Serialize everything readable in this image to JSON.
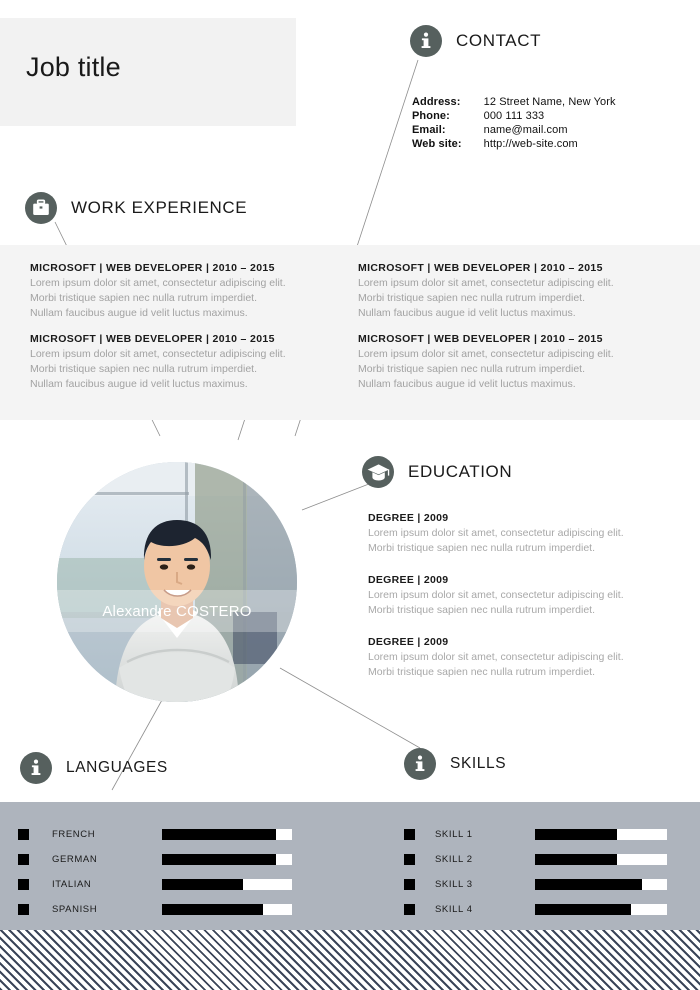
{
  "header": {
    "job_title": "Job title"
  },
  "colors": {
    "icon_circle": "#56605e",
    "header_band": "#f2f2f2",
    "work_band": "#f4f4f4",
    "bottom_band": "#aeb4bd",
    "stripe_dark": "#3b4559",
    "body_text": "#a2a2a2",
    "heading_text": "#1a1a1a"
  },
  "sections": {
    "contact": {
      "title": "CONTACT",
      "icon": "info-icon"
    },
    "work": {
      "title": "WORK EXPERIENCE",
      "icon": "briefcase-icon"
    },
    "education": {
      "title": "EDUCATION",
      "icon": "graduation-cap-icon"
    },
    "languages": {
      "title": "LANGUAGES",
      "icon": "info-icon"
    },
    "skills": {
      "title": "SKILLS",
      "icon": "info-icon"
    }
  },
  "contact": {
    "rows": [
      {
        "label": "Address:",
        "value": "12 Street Name, New York"
      },
      {
        "label": "Phone:",
        "value": "000 111 333"
      },
      {
        "label": "Email:",
        "value": "name@mail.com"
      },
      {
        "label": "Web site:",
        "value": "http://web-site.com"
      }
    ]
  },
  "work_experience": {
    "left": [
      {
        "heading": "MICROSOFT | WEB  DEVELOPER | 2010 – 2015",
        "lines": [
          "Lorem ipsum dolor sit amet, consectetur adipiscing elit.",
          "Morbi tristique sapien nec nulla rutrum imperdiet.",
          "Nullam faucibus augue id velit luctus maximus."
        ]
      },
      {
        "heading": "MICROSOFT | WEB  DEVELOPER | 2010 – 2015",
        "lines": [
          "Lorem ipsum dolor sit amet, consectetur adipiscing elit.",
          "Morbi tristique sapien nec nulla rutrum imperdiet.",
          "Nullam faucibus augue id velit luctus maximus."
        ]
      }
    ],
    "right": [
      {
        "heading": "MICROSOFT | WEB  DEVELOPER | 2010 – 2015",
        "lines": [
          "Lorem ipsum dolor sit amet, consectetur adipiscing elit.",
          "Morbi tristique sapien nec nulla rutrum imperdiet.",
          "Nullam faucibus augue id velit luctus maximus."
        ]
      },
      {
        "heading": "MICROSOFT | WEB  DEVELOPER | 2010 – 2015",
        "lines": [
          "Lorem ipsum dolor sit amet, consectetur adipiscing elit.",
          "Morbi tristique sapien nec nulla rutrum imperdiet.",
          "Nullam faucibus augue id velit luctus maximus."
        ]
      }
    ]
  },
  "profile": {
    "name": "Alexandre COSTERO"
  },
  "education": [
    {
      "heading": "DEGREE | 2009",
      "lines": [
        "Lorem ipsum dolor sit amet, consectetur adipiscing elit.",
        "Morbi tristique sapien nec nulla rutrum imperdiet."
      ]
    },
    {
      "heading": "DEGREE | 2009",
      "lines": [
        "Lorem ipsum dolor sit amet, consectetur adipiscing elit.",
        "Morbi tristique sapien nec nulla rutrum imperdiet."
      ]
    },
    {
      "heading": "DEGREE | 2009",
      "lines": [
        "Lorem ipsum dolor sit amet, consectetur adipiscing elit.",
        "Morbi tristique sapien nec nulla rutrum imperdiet."
      ]
    }
  ],
  "languages": [
    {
      "label": "FRENCH",
      "level": 88
    },
    {
      "label": "GERMAN",
      "level": 88
    },
    {
      "label": "ITALIAN",
      "level": 62
    },
    {
      "label": "SPANISH",
      "level": 78
    }
  ],
  "skills": [
    {
      "label": "SKILL 1",
      "level": 62
    },
    {
      "label": "SKILL 2",
      "level": 62
    },
    {
      "label": "SKILL 3",
      "level": 81
    },
    {
      "label": "SKILL 4",
      "level": 73
    }
  ]
}
